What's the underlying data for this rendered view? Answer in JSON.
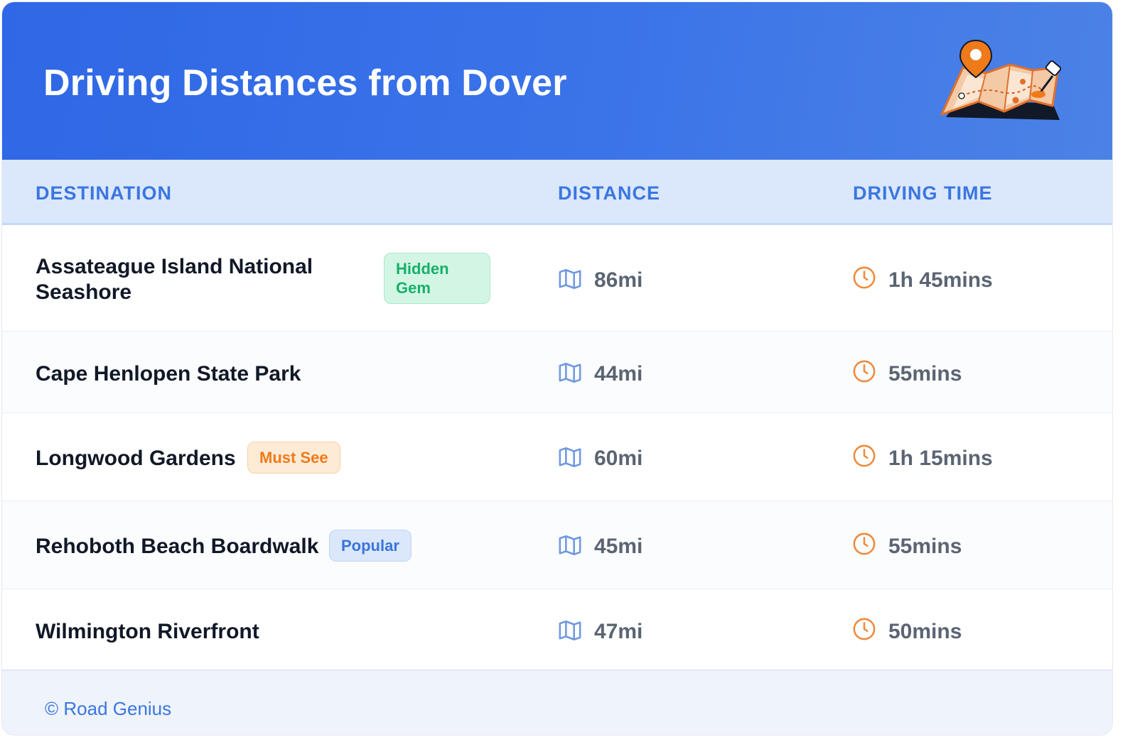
{
  "header": {
    "title": "Driving Distances from Dover",
    "illustration": "map-with-pins-illustration"
  },
  "table": {
    "columns": [
      "DESTINATION",
      "DISTANCE",
      "DRIVING TIME"
    ],
    "rows": [
      {
        "destination": "Assateague Island National Seashore",
        "badge": "Hidden Gem",
        "badge_color": "#17b06b",
        "distance": "86mi",
        "time": "1h 45mins"
      },
      {
        "destination": "Cape Henlopen State Park",
        "badge": "",
        "distance": "44mi",
        "time": "55mins"
      },
      {
        "destination": "Longwood Gardens",
        "badge": "Must See",
        "badge_color": "#ef7a1a",
        "distance": "60mi",
        "time": "1h 15mins"
      },
      {
        "destination": "Rehoboth Beach Boardwalk",
        "badge": "Popular",
        "badge_color": "#3a74dc",
        "distance": "45mi",
        "time": "55mins"
      },
      {
        "destination": "Wilmington Riverfront",
        "badge": "",
        "distance": "47mi",
        "time": "50mins"
      }
    ]
  },
  "footer": {
    "credit": "© Road Genius"
  },
  "icons": {
    "distance": "map-icon",
    "time": "clock-icon"
  },
  "colors": {
    "header_gradient_start": "#2f67e6",
    "header_gradient_end": "#4c82e6",
    "accent_blue": "#3b76e0",
    "clock_orange": "#f08a3c",
    "map_icon_blue": "#6f98e0"
  }
}
